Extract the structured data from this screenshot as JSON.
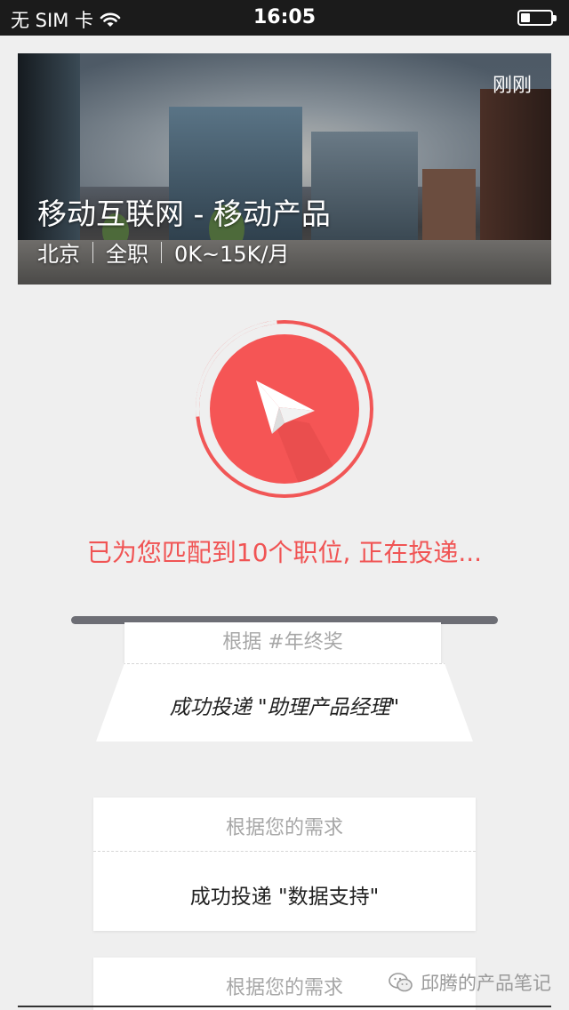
{
  "status_bar": {
    "carrier": "无 SIM 卡",
    "time": "16:05",
    "wifi_icon": "wifi-icon",
    "battery_icon": "battery-icon"
  },
  "job": {
    "posted": "刚刚",
    "title": "移动互联网 - 移动产品",
    "city": "北京",
    "type": "全职",
    "salary": "0K~15K/月"
  },
  "send": {
    "icon": "paper-plane-icon",
    "status": "已为您匹配到10个职位, 正在投递..."
  },
  "cards": [
    {
      "reason": "根据 #年终奖",
      "result": "成功投递 \"助理产品经理\""
    },
    {
      "reason": "根据您的需求",
      "result": "成功投递 \"数据支持\""
    },
    {
      "reason": "根据您的需求"
    }
  ],
  "watermark": {
    "icon": "wechat-icon",
    "text": "邱腾的产品笔记"
  },
  "colors": {
    "accent": "#f55555",
    "text_accent": "#f05454",
    "background": "#efefef"
  }
}
